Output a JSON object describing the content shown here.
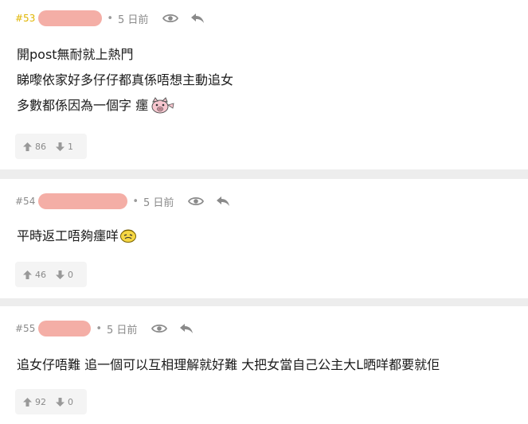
{
  "posts": [
    {
      "number": "#53",
      "is_op": true,
      "time": "5 日前",
      "lines": [
        "開post無耐就上熱門",
        "睇嚟依家好多仔仔都真係唔想主動追女",
        "多數都係因為一個字 癦"
      ],
      "sticker": "pig-face-sticker",
      "upvotes": "86",
      "downvotes": "1"
    },
    {
      "number": "#54",
      "is_op": false,
      "time": "5 日前",
      "lines": [
        "平時返工唔夠癦咩"
      ],
      "sticker": "yellow-face-sticker",
      "upvotes": "46",
      "downvotes": "0"
    },
    {
      "number": "#55",
      "is_op": false,
      "time": "5 日前",
      "lines": [
        "追女仔唔難 追一個可以互相理解就好難 大把女當自己公主大L晒咩都要就佢"
      ],
      "sticker": "",
      "upvotes": "92",
      "downvotes": "0"
    }
  ],
  "separator": "•",
  "icons": {
    "view": "eye-icon",
    "reply": "reply-arrow-icon",
    "upvote": "arrow-up-icon",
    "downvote": "arrow-down-icon"
  },
  "colors": {
    "op_number": "#e0b500",
    "username_mask": "#f4aea6",
    "meta_text": "#8a8a8a",
    "divider": "#ededed"
  }
}
